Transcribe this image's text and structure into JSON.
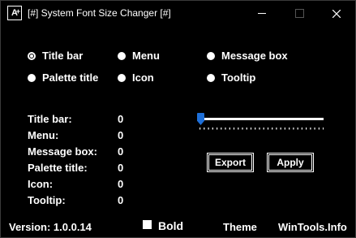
{
  "window": {
    "title": "[#] System Font Size Changer [#]",
    "app_icon": "A",
    "app_icon_plus": "+",
    "controls": [
      "minimize-icon",
      "maximize-icon",
      "close-icon"
    ]
  },
  "radios": [
    {
      "label": "Title bar",
      "selected": true
    },
    {
      "label": "Menu",
      "selected": false
    },
    {
      "label": "Message box",
      "selected": false
    },
    {
      "label": "Palette title",
      "selected": false
    },
    {
      "label": "Icon",
      "selected": false
    },
    {
      "label": "Tooltip",
      "selected": false
    }
  ],
  "stats": [
    {
      "label": "Title bar:",
      "value": "0"
    },
    {
      "label": "Menu:",
      "value": "0"
    },
    {
      "label": "Message box:",
      "value": "0"
    },
    {
      "label": "Palette title:",
      "value": "0"
    },
    {
      "label": "Icon:",
      "value": "0"
    },
    {
      "label": "Tooltip:",
      "value": "0"
    }
  ],
  "slider": {
    "position": 0,
    "accent": "#1e6fd8"
  },
  "buttons": {
    "export": "Export",
    "apply": "Apply"
  },
  "footer": {
    "version": "Version: 1.0.0.14",
    "bold_label": "Bold",
    "bold_checked": false,
    "theme": "Theme",
    "site": "WinTools.Info"
  }
}
